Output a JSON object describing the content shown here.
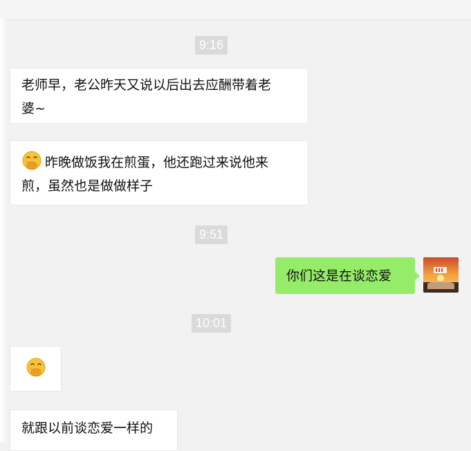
{
  "chat": {
    "timestamps": [
      "9:16",
      "9:51",
      "10:01"
    ],
    "messages": [
      {
        "side": "incoming",
        "lines": [
          "老师早，老公昨天又说以后出去应酬带着老",
          "婆~"
        ]
      },
      {
        "side": "incoming",
        "emoji": "face-with-hand-over-mouth-icon",
        "lines": [
          "昨晚做饭我在煎蛋，他还跑过来说他来",
          "煎，虽然也是做做样子"
        ]
      },
      {
        "side": "outgoing",
        "text": "你们这是在谈恋爱"
      },
      {
        "side": "incoming",
        "emoji": "face-with-hand-over-mouth-icon"
      },
      {
        "side": "incoming",
        "text": "就跟以前谈恋爱一样的"
      }
    ]
  },
  "colors": {
    "background": "#f2f2f2",
    "incoming_bubble": "#ffffff",
    "outgoing_bubble": "#95ec69",
    "timestamp_bg": "#dadada"
  }
}
